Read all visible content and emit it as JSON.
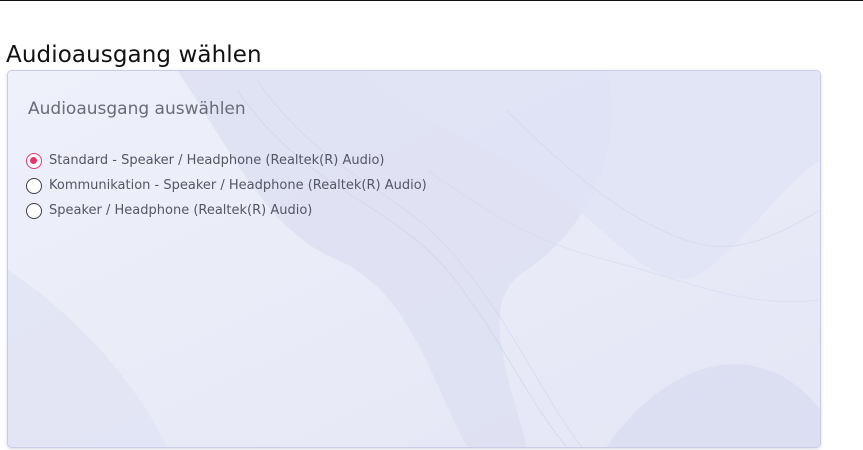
{
  "window": {
    "title": "Audioausgang wählen"
  },
  "dialog": {
    "heading": "Audioausgang auswählen",
    "options": [
      {
        "label": "Standard - Speaker / Headphone (Realtek(R) Audio)",
        "selected": true
      },
      {
        "label": "Kommunikation - Speaker / Headphone (Realtek(R) Audio)",
        "selected": false
      },
      {
        "label": "Speaker / Headphone (Realtek(R) Audio)",
        "selected": false
      }
    ]
  },
  "colors": {
    "accent": "#e8356d",
    "dialog_background": "#e9ebf8",
    "dialog_border": "#c9cde6",
    "label_text": "#555664",
    "heading_text": "#6a6b78"
  }
}
